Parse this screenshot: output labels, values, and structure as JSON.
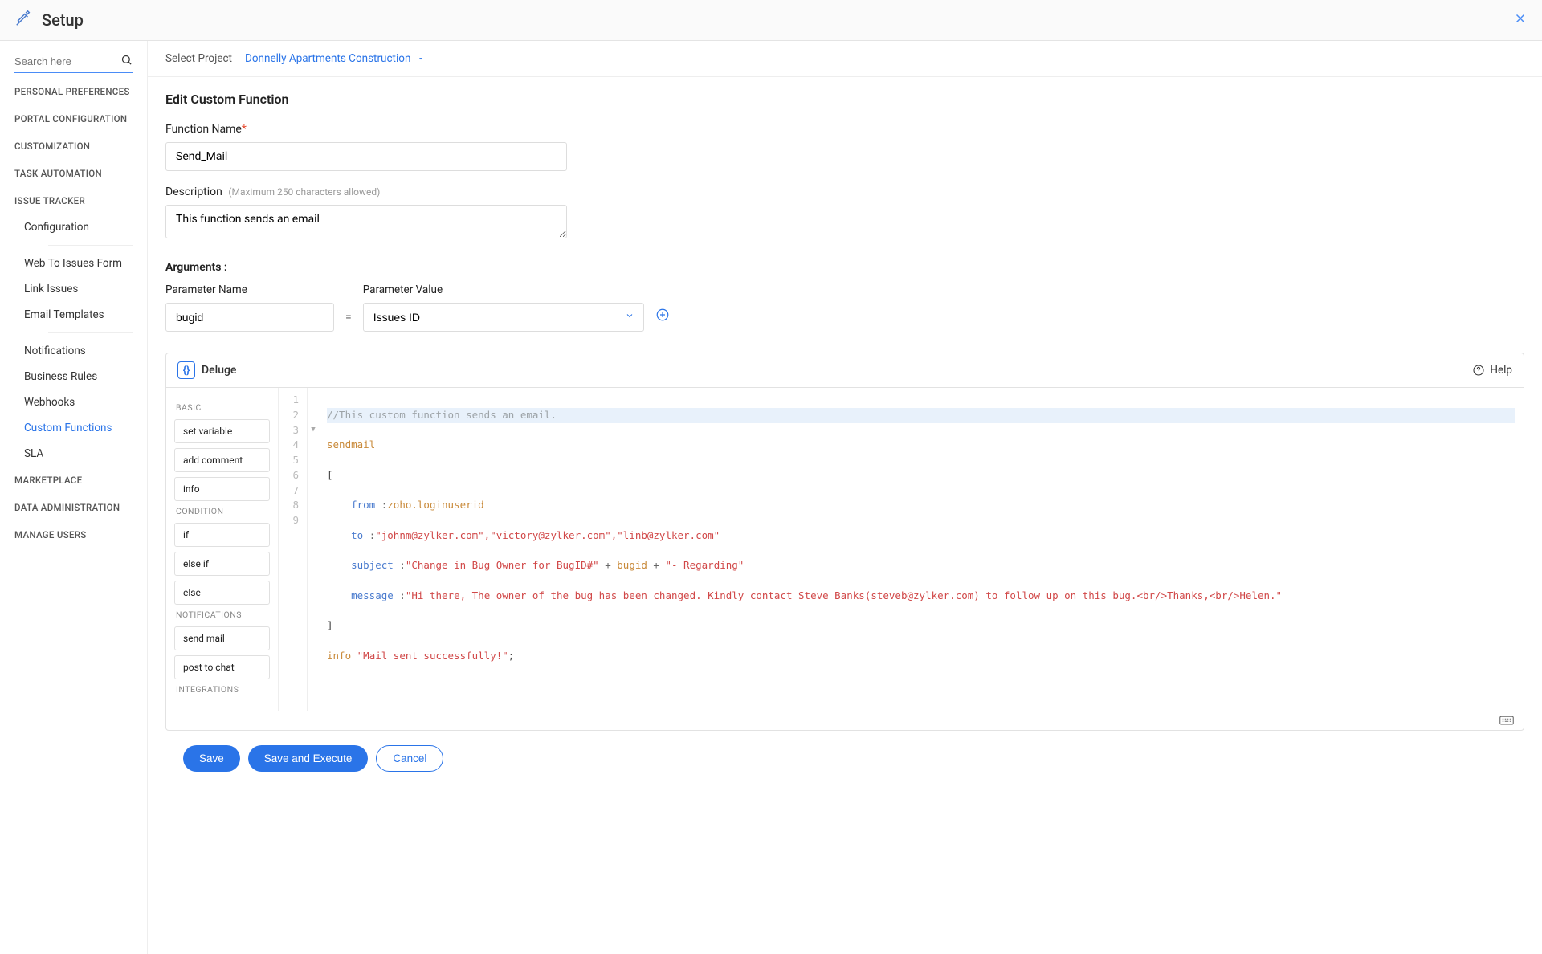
{
  "header": {
    "title": "Setup"
  },
  "sidebar": {
    "search_placeholder": "Search here",
    "sections": [
      "PERSONAL PREFERENCES",
      "PORTAL CONFIGURATION",
      "CUSTOMIZATION",
      "TASK AUTOMATION",
      "ISSUE TRACKER"
    ],
    "issue_tracker_items": [
      "Configuration",
      "Web To Issues Form",
      "Link Issues",
      "Email Templates",
      "Notifications",
      "Business Rules",
      "Webhooks",
      "Custom Functions",
      "SLA"
    ],
    "tail_sections": [
      "MARKETPLACE",
      "DATA ADMINISTRATION",
      "MANAGE USERS"
    ]
  },
  "project": {
    "label": "Select Project",
    "name": "Donnelly Apartments Construction"
  },
  "page": {
    "title": "Edit Custom Function",
    "function_name_label": "Function Name",
    "function_name_value": "Send_Mail",
    "description_label": "Description",
    "description_hint": "(Maximum 250 characters allowed)",
    "description_value": "This function sends an email",
    "arguments_label": "Arguments :",
    "param_name_label": "Parameter Name",
    "param_name_value": "bugid",
    "param_value_label": "Parameter Value",
    "param_value_selected": "Issues ID"
  },
  "deluge": {
    "name": "Deluge",
    "help_label": "Help",
    "snippet_groups": [
      {
        "title": "BASIC",
        "items": [
          "set variable",
          "add comment",
          "info"
        ]
      },
      {
        "title": "CONDITION",
        "items": [
          "if",
          "else if",
          "else"
        ]
      },
      {
        "title": "NOTIFICATIONS",
        "items": [
          "send mail",
          "post to chat"
        ]
      },
      {
        "title": "INTEGRATIONS",
        "items": []
      }
    ],
    "code": {
      "line1_comment": "//This custom function sends an email.",
      "line2_kw": "sendmail",
      "line4_from": "from ",
      "line4_colon": ":",
      "line4_val": "zoho.loginuserid",
      "line5_to": "to ",
      "line5_str": "\"johnm@zylker.com\",\"victory@zylker.com\",\"linb@zylker.com\"",
      "line6_subject": "subject ",
      "line6_str1": "\"Change in Bug Owner for BugID#\"",
      "line6_plus": " + ",
      "line6_var": "bugid",
      "line6_str2": "\"- Regarding\"",
      "line7_message": "message ",
      "line7_str": "\"Hi there, The owner of the bug has been changed. Kindly contact Steve Banks(steveb@zylker.com) to follow up on this bug.<br/>Thanks,<br/>Helen.\"",
      "line9_info": "info ",
      "line9_str": "\"Mail sent successfully!\"",
      "line9_end": ";"
    }
  },
  "actions": {
    "save": "Save",
    "save_execute": "Save and Execute",
    "cancel": "Cancel"
  }
}
